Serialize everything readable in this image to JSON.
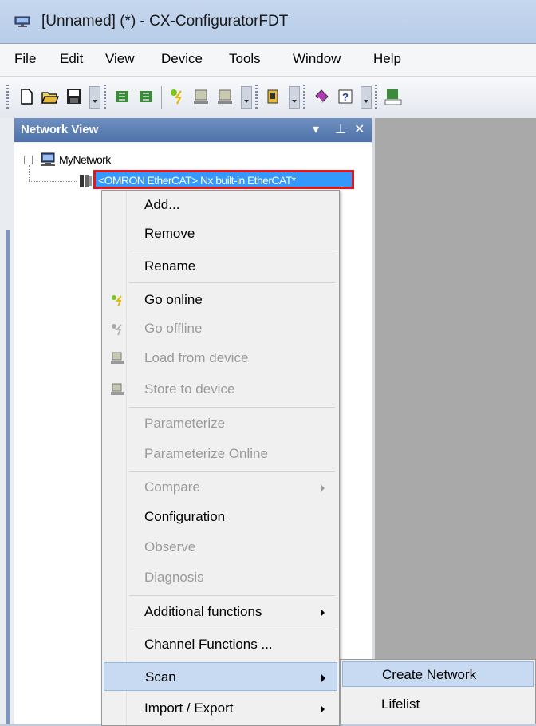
{
  "window": {
    "title": "[Unnamed] (*)  - CX-ConfiguratorFDT",
    "icon": "app-network-icon"
  },
  "menubar": {
    "items": [
      "File",
      "Edit",
      "View",
      "Device",
      "Tools",
      "Window",
      "Help"
    ]
  },
  "toolbar": {
    "icons": [
      "new-file-icon",
      "open-folder-icon",
      "save-icon",
      "add-device-icon",
      "remove-device-icon",
      "go-online-icon",
      "load-from-device-icon",
      "store-to-device-icon",
      "catalog-icon",
      "manual-icon",
      "help-icon",
      "html-report-icon"
    ]
  },
  "network_view": {
    "title": "Network View",
    "controls": {
      "dropdown": "▾",
      "pin": "⊥",
      "close": "✕"
    },
    "tree": {
      "root_label": "MyNetwork",
      "device_label": "<OMRON EtherCAT> Nx built-in EtherCAT*"
    }
  },
  "context_menu": {
    "items": [
      {
        "label": "Add...",
        "enabled": true
      },
      {
        "label": "Remove",
        "enabled": true
      },
      {
        "label": "Rename",
        "enabled": true
      },
      {
        "label": "Go online",
        "enabled": true,
        "icon": "go-online-icon"
      },
      {
        "label": "Go offline",
        "enabled": false,
        "icon": "go-offline-icon"
      },
      {
        "label": "Load from device",
        "enabled": false,
        "icon": "load-from-device-icon"
      },
      {
        "label": "Store to device",
        "enabled": false,
        "icon": "store-to-device-icon"
      },
      {
        "label": "Parameterize",
        "enabled": false
      },
      {
        "label": "Parameterize Online",
        "enabled": false
      },
      {
        "label": "Compare",
        "enabled": false,
        "submenu": true
      },
      {
        "label": "Configuration",
        "enabled": true
      },
      {
        "label": "Observe",
        "enabled": false
      },
      {
        "label": "Diagnosis",
        "enabled": false
      },
      {
        "label": "Additional functions",
        "enabled": true,
        "submenu": true
      },
      {
        "label": "Channel Functions ...",
        "enabled": true
      },
      {
        "label": "Scan",
        "enabled": true,
        "submenu": true,
        "highlighted": true
      },
      {
        "label": "Import / Export",
        "enabled": true,
        "submenu": true
      }
    ]
  },
  "scan_submenu": {
    "items": [
      {
        "label": "Create Network",
        "highlighted": true
      },
      {
        "label": "Lifelist"
      }
    ]
  },
  "colors": {
    "selection_fill": "#3399ff",
    "selection_outline": "#e8141b",
    "panel_header": "#5b7fb5",
    "menu_highlight": "#c7daf2"
  }
}
